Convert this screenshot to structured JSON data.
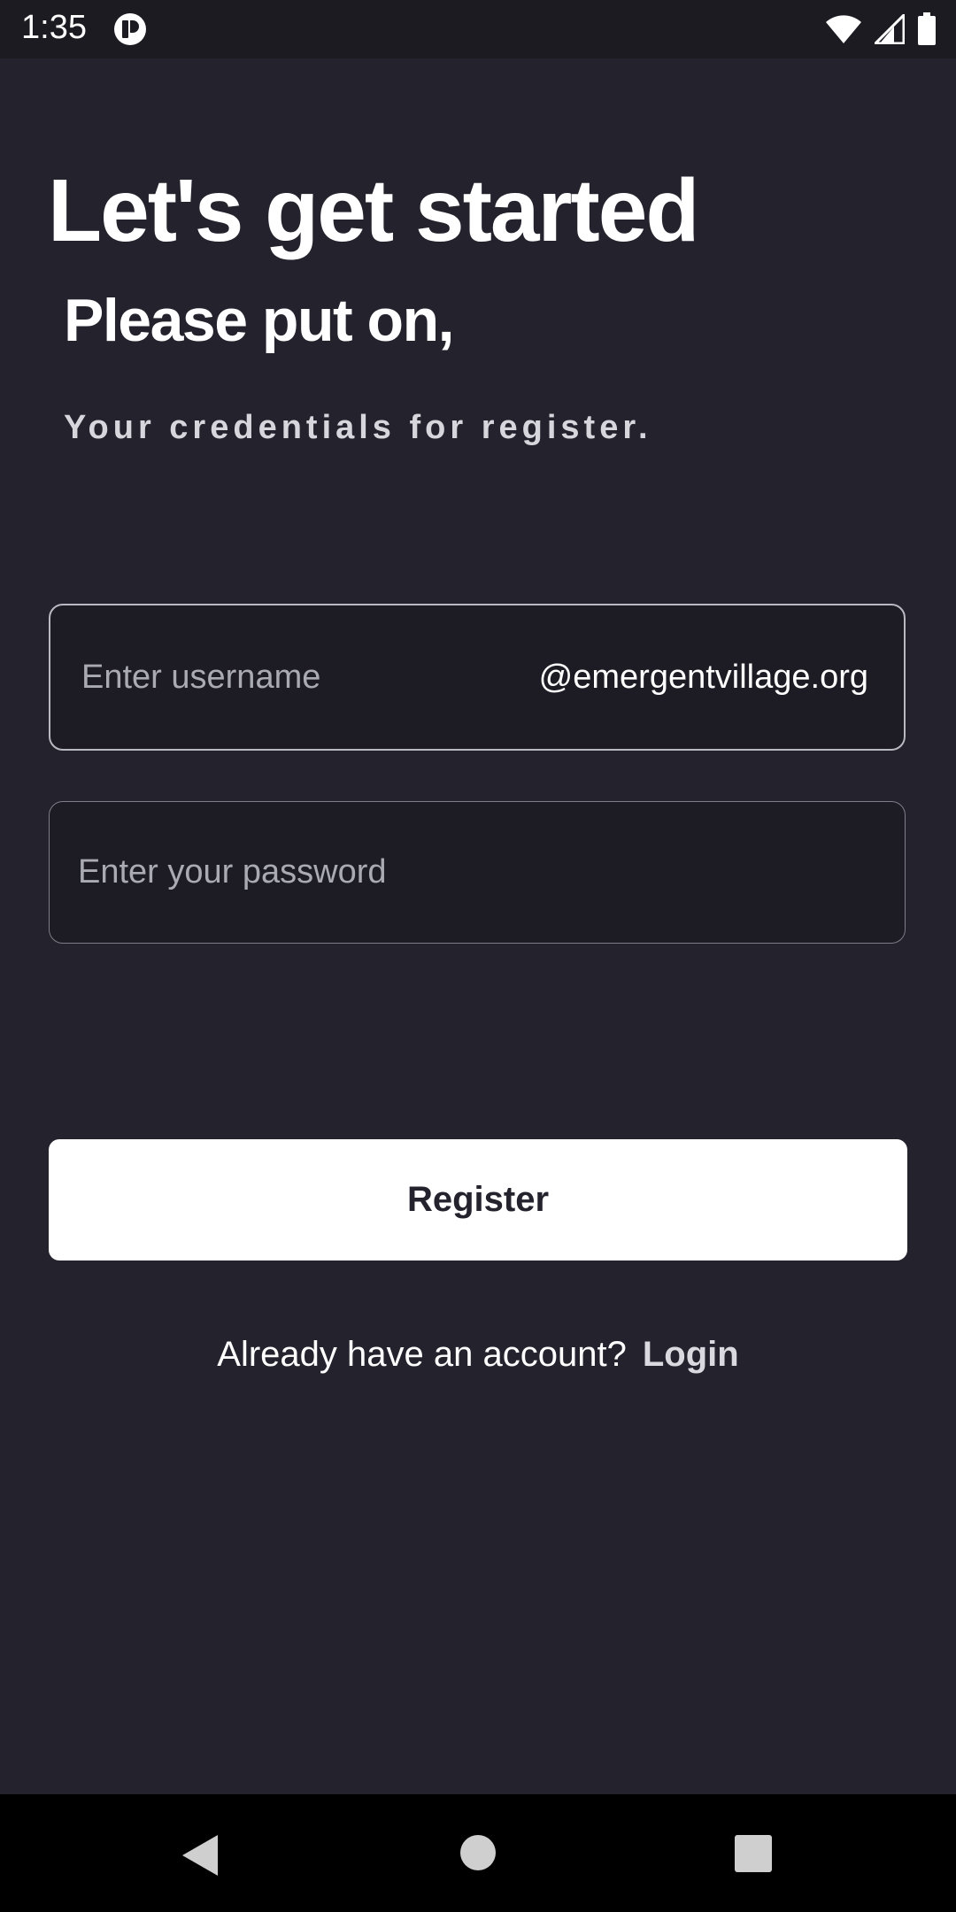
{
  "status_bar": {
    "time": "1:35",
    "app_icon": "notification-app-icon",
    "icons": [
      "wifi-icon",
      "cell-signal-icon",
      "battery-icon"
    ]
  },
  "header": {
    "title": "Let's get started",
    "subtitle": "Please put on,",
    "caption": "Your credentials for register."
  },
  "form": {
    "username_placeholder": "Enter username",
    "username_value": "",
    "username_suffix": "@emergentvillage.org",
    "password_placeholder": "Enter your password",
    "password_value": "",
    "register_label": "Register"
  },
  "footer": {
    "prompt": "Already have an account?",
    "login_label": "Login"
  },
  "nav": {
    "icons": [
      "back-icon",
      "home-icon",
      "recents-icon"
    ]
  },
  "colors": {
    "background": "#23222d",
    "field_background": "#1d1c24",
    "button_background": "#ffffff",
    "button_text": "#23222d"
  }
}
